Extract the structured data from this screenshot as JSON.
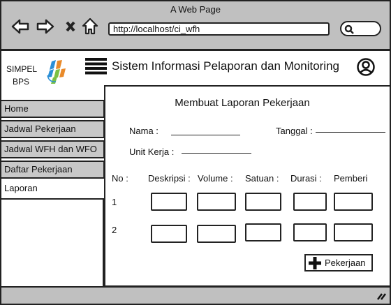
{
  "browser": {
    "title": "A Web Page",
    "url": "http://localhost/ci_wfh",
    "icons": [
      "back-arrow-icon",
      "forward-arrow-icon",
      "close-x-icon",
      "home-icon",
      "search-icon"
    ]
  },
  "header": {
    "brand_line1": "SIMPEL",
    "brand_line2": "BPS",
    "app_title": "Sistem Informasi Pelaporan dan Monitoring"
  },
  "sidebar": {
    "items": [
      {
        "label": "Home"
      },
      {
        "label": "Jadwal Pekerjaan"
      },
      {
        "label": "Jadwal WFH dan WFO"
      },
      {
        "label": "Daftar Pekerjaan"
      },
      {
        "label": "Laporan"
      }
    ],
    "active": "Laporan"
  },
  "form": {
    "title": "Membuat Laporan Pekerjaan",
    "nama_label": "Nama :",
    "tanggal_label": "Tanggal :",
    "unit_label": "Unit Kerja :",
    "columns": [
      "No :",
      "Deskripsi :",
      "Volume :",
      "Satuan :",
      "Durasi :",
      "Pemberi"
    ],
    "rows": [
      "1",
      "2"
    ],
    "add_button": "Pekerjaan"
  }
}
